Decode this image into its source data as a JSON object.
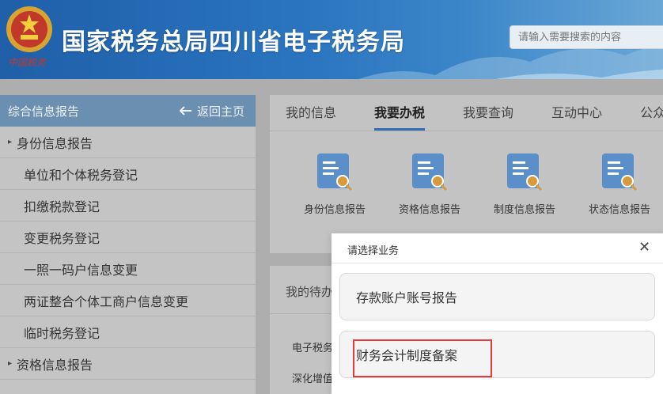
{
  "header": {
    "title": "国家税务总局四川省电子税务局",
    "emblem_caption": "中国税务",
    "search_placeholder": "请输入需要搜索的内容"
  },
  "sidebar": {
    "heading": "综合信息报告",
    "back_label": "返回主页",
    "items": [
      {
        "label": "身份信息报告",
        "type": "group"
      },
      {
        "label": "单位和个体税务登记",
        "type": "sub"
      },
      {
        "label": "扣缴税款登记",
        "type": "sub"
      },
      {
        "label": "变更税务登记",
        "type": "sub"
      },
      {
        "label": "一照一码户信息变更",
        "type": "sub"
      },
      {
        "label": "两证整合个体工商户信息变更",
        "type": "sub"
      },
      {
        "label": "临时税务登记",
        "type": "sub"
      },
      {
        "label": "资格信息报告",
        "type": "group"
      }
    ]
  },
  "main": {
    "tabs": [
      {
        "label": "我的信息"
      },
      {
        "label": "我要办税"
      },
      {
        "label": "我要查询"
      },
      {
        "label": "互动中心"
      },
      {
        "label": "公众服务"
      }
    ],
    "active_tab": "我要办税",
    "shortcuts": [
      {
        "label": "身份信息报告",
        "icon": "report-icon"
      },
      {
        "label": "资格信息报告",
        "icon": "report-icon"
      },
      {
        "label": "制度信息报告",
        "icon": "report-icon"
      },
      {
        "label": "状态信息报告",
        "icon": "report-icon"
      }
    ],
    "todo_title": "我的待办",
    "todo_rows": [
      "电子税务",
      "深化增值"
    ]
  },
  "modal": {
    "title": "请选择业务",
    "close_glyph": "✕",
    "options": [
      {
        "label": "存款账户账号报告"
      },
      {
        "label": "财务会计制度备案"
      }
    ]
  },
  "colors": {
    "header_blue": "#2a74bf",
    "sidebar_head": "#6a8fb1",
    "active_tab_underline": "#2f6db0",
    "highlight_red": "#e23b3b"
  }
}
